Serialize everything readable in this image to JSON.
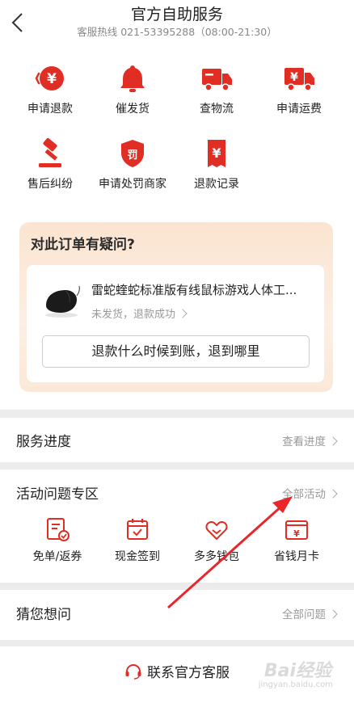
{
  "header": {
    "title": "官方自助服务",
    "hotline": "客服热线 021-53395288（08:00-21:30）"
  },
  "services": [
    {
      "label": "申请退款",
      "icon": "refund-icon"
    },
    {
      "label": "催发货",
      "icon": "bell-icon"
    },
    {
      "label": "查物流",
      "icon": "truck-icon"
    },
    {
      "label": "申请运费",
      "icon": "freight-icon"
    },
    {
      "label": "售后纠纷",
      "icon": "gavel-icon"
    },
    {
      "label": "申请处罚商家",
      "icon": "penalty-shield-icon"
    },
    {
      "label": "退款记录",
      "icon": "refund-record-icon"
    }
  ],
  "question_card": {
    "title": "对此订单有疑问?",
    "product_name": "雷蛇蝰蛇标准版有线鼠标游戏人体工...",
    "status": "未发货，退款成功",
    "button": "退款什么时候到账，退到哪里"
  },
  "progress": {
    "title": "服务进度",
    "link": "查看进度"
  },
  "activity": {
    "title": "活动问题专区",
    "link": "全部活动",
    "items": [
      {
        "label": "免单/返券",
        "icon": "coupon-icon"
      },
      {
        "label": "现金签到",
        "icon": "calendar-check-icon"
      },
      {
        "label": "多多钱包",
        "icon": "wallet-heart-icon"
      },
      {
        "label": "省钱月卡",
        "icon": "money-card-icon"
      }
    ]
  },
  "guess": {
    "title": "猜您想问",
    "link": "全部问题"
  },
  "footer": {
    "contact": "联系官方客服"
  },
  "watermark": {
    "logo": "Bai经验",
    "url": "jingyan.baidu.com"
  },
  "colors": {
    "accent": "#e02e24",
    "arrow": "#e8262c"
  }
}
